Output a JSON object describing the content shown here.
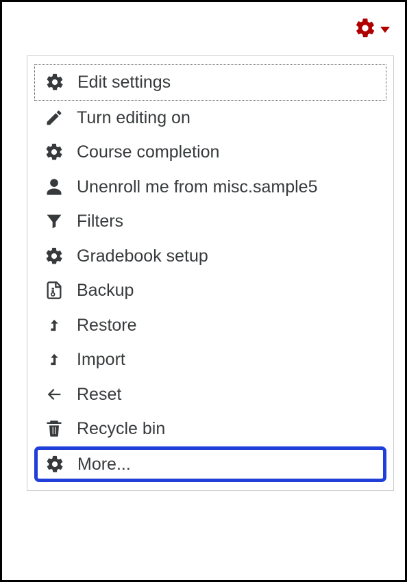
{
  "gear_color": "#b00000",
  "menu": {
    "items": [
      {
        "icon": "gear-icon",
        "label": "Edit settings",
        "focused": true
      },
      {
        "icon": "pencil-icon",
        "label": "Turn editing on"
      },
      {
        "icon": "gear-icon",
        "label": "Course completion"
      },
      {
        "icon": "user-icon",
        "label": "Unenroll me from misc.sample5"
      },
      {
        "icon": "funnel-icon",
        "label": "Filters"
      },
      {
        "icon": "gear-icon",
        "label": "Gradebook setup"
      },
      {
        "icon": "zip-file-icon",
        "label": "Backup"
      },
      {
        "icon": "arrow-up-turn-icon",
        "label": "Restore"
      },
      {
        "icon": "arrow-up-turn-icon",
        "label": "Import"
      },
      {
        "icon": "arrow-left-icon",
        "label": "Reset"
      },
      {
        "icon": "trash-icon",
        "label": "Recycle bin"
      },
      {
        "icon": "gear-icon",
        "label": "More...",
        "highlighted": true
      }
    ]
  }
}
